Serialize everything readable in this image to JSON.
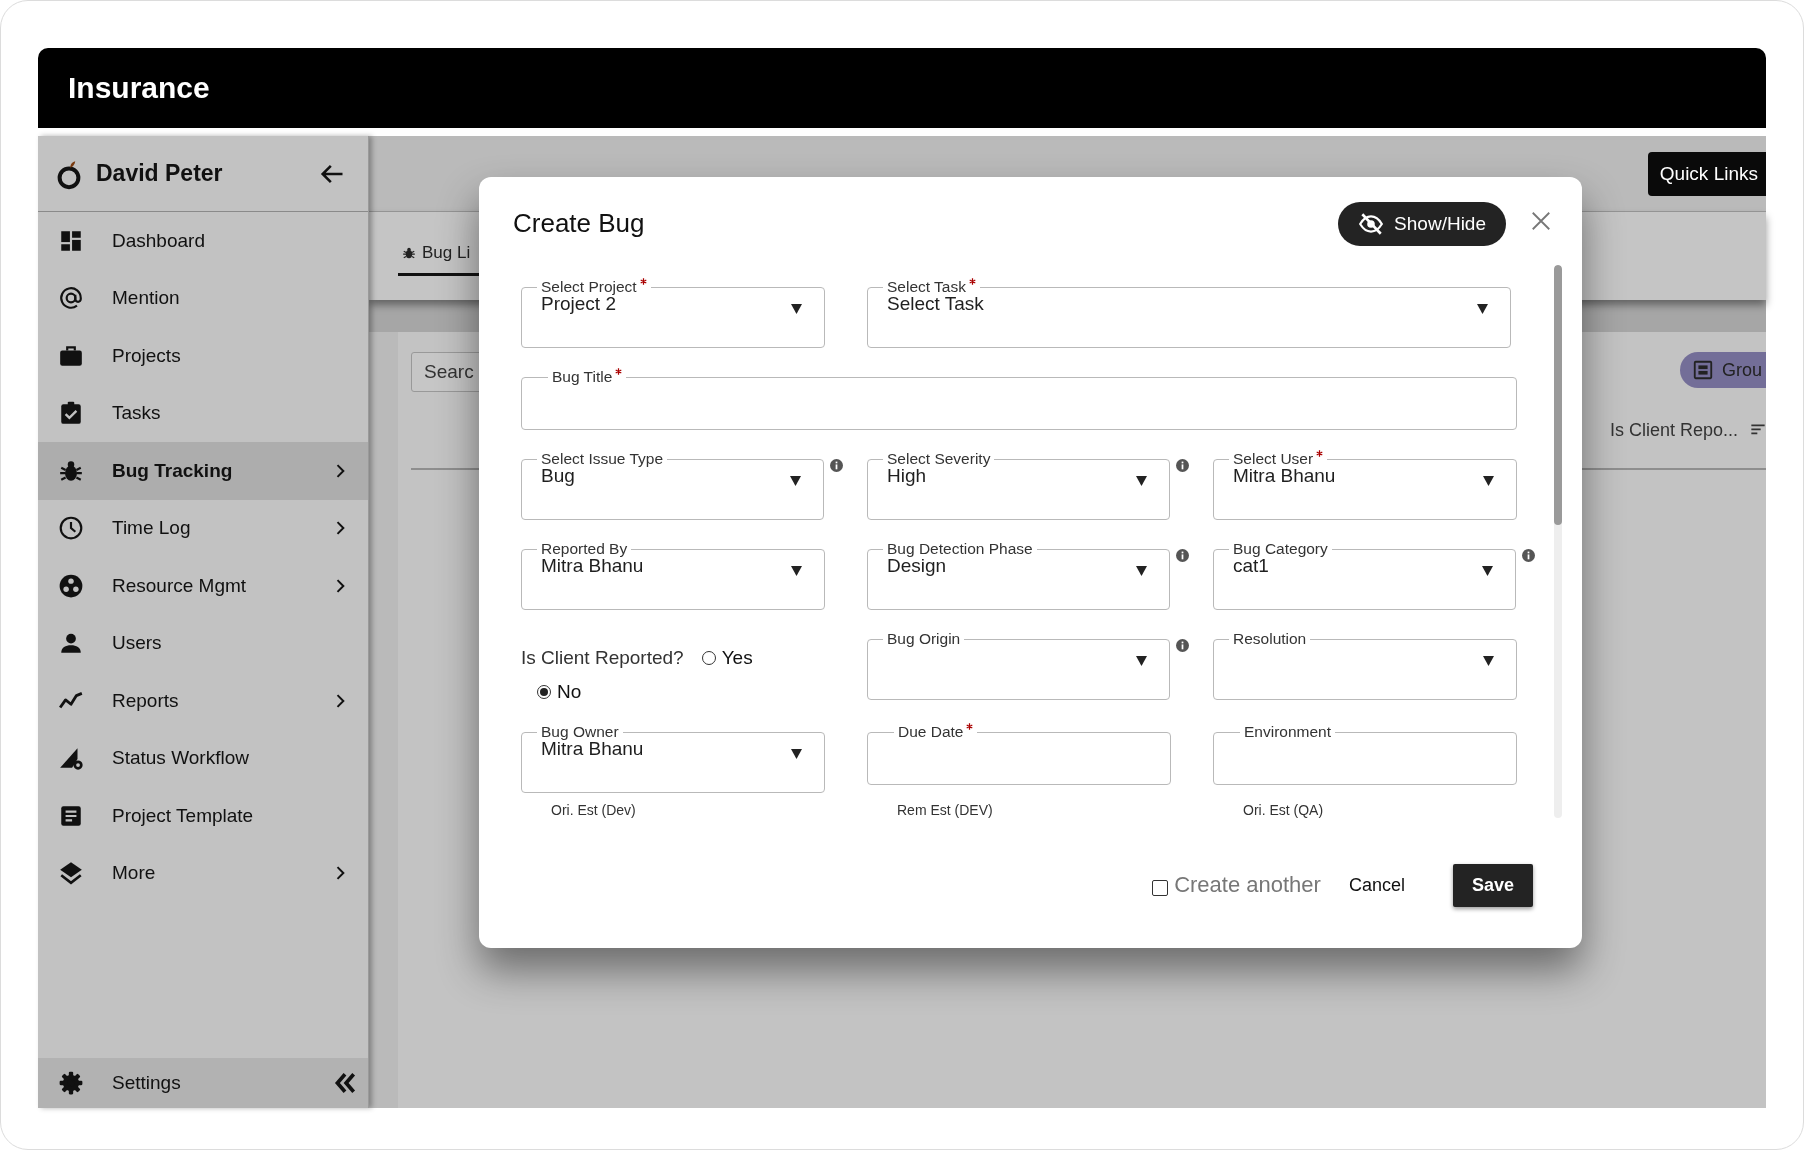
{
  "app_title": "Insurance",
  "sidebar": {
    "user_name": "David Peter",
    "items": [
      {
        "label": "Dashboard",
        "selected": false,
        "expandable": false
      },
      {
        "label": "Mention",
        "selected": false,
        "expandable": false
      },
      {
        "label": "Projects",
        "selected": false,
        "expandable": false
      },
      {
        "label": "Tasks",
        "selected": false,
        "expandable": false
      },
      {
        "label": "Bug Tracking",
        "selected": true,
        "expandable": true
      },
      {
        "label": "Time Log",
        "selected": false,
        "expandable": true
      },
      {
        "label": "Resource Mgmt",
        "selected": false,
        "expandable": true
      },
      {
        "label": "Users",
        "selected": false,
        "expandable": false
      },
      {
        "label": "Reports",
        "selected": false,
        "expandable": true
      },
      {
        "label": "Status Workflow",
        "selected": false,
        "expandable": false
      },
      {
        "label": "Project Template",
        "selected": false,
        "expandable": false
      },
      {
        "label": "More",
        "selected": false,
        "expandable": true
      }
    ],
    "footer_item": {
      "label": "Settings"
    }
  },
  "background": {
    "quick_links": "Quick Links",
    "tab": {
      "label": "Bug Li",
      "selected": true
    },
    "search": {
      "placeholder": "Searc"
    },
    "group_button": "Grou",
    "column_header": "Is Client Repo..."
  },
  "modal": {
    "title": "Create Bug",
    "show_hide": "Show/Hide",
    "rows": [
      [
        {
          "kind": "select",
          "label": "Select Project",
          "required": true,
          "info": false,
          "value": "Project 2"
        },
        {
          "kind": "select",
          "label": "Select Task",
          "required": true,
          "info": false,
          "value": "Select Task"
        }
      ],
      [
        {
          "kind": "input",
          "label": "Bug Title",
          "required": true,
          "info": false
        }
      ],
      [
        {
          "kind": "select",
          "label": "Select Issue Type",
          "required": false,
          "info": true,
          "value": "Bug"
        },
        {
          "kind": "select",
          "label": "Select Severity",
          "required": false,
          "info": true,
          "value": "High"
        },
        {
          "kind": "select",
          "label": "Select User",
          "required": true,
          "info": false,
          "value": "Mitra Bhanu"
        }
      ],
      [
        {
          "kind": "select",
          "label": "Reported By",
          "required": false,
          "info": false,
          "value": "Mitra Bhanu"
        },
        {
          "kind": "select",
          "label": "Bug Detection Phase",
          "required": false,
          "info": true,
          "value": "Design"
        },
        {
          "kind": "select",
          "label": "Bug Category",
          "required": false,
          "info": true,
          "value": "cat1"
        }
      ],
      [
        {
          "kind": "radio",
          "label": "Is Client Reported?",
          "options": [
            {
              "label": "Yes",
              "selected": false
            },
            {
              "label": "No",
              "selected": true
            }
          ]
        },
        {
          "kind": "select",
          "label": "Bug Origin",
          "required": false,
          "info": true
        },
        {
          "kind": "select",
          "label": "Resolution",
          "required": false,
          "info": false
        }
      ],
      [
        {
          "kind": "select",
          "label": "Bug Owner",
          "required": false,
          "info": false,
          "value": "Mitra Bhanu"
        },
        {
          "kind": "input",
          "label": "Due Date",
          "required": true,
          "info": false
        },
        {
          "kind": "input",
          "label": "Environment",
          "required": false,
          "info": false
        }
      ]
    ],
    "partial_labels": [
      "Ori. Est (Dev)",
      "Rem Est (DEV)",
      "Ori. Est (QA)"
    ],
    "create_another": {
      "label": "Create another",
      "checked": false
    },
    "buttons": [
      {
        "label": "Cancel",
        "kind": "plain"
      },
      {
        "label": "Save",
        "kind": "filled"
      }
    ]
  }
}
